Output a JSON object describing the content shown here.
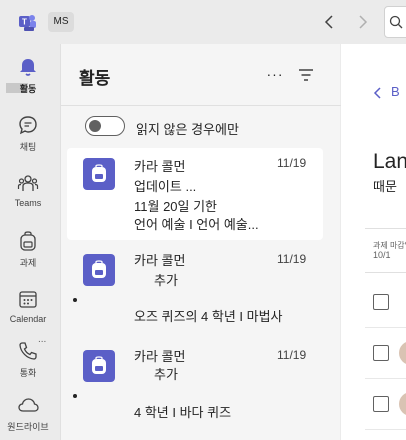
{
  "topbar": {
    "tenant": "MS",
    "app_icon": "teams-icon",
    "nav_back_icon": "chevron-left-icon",
    "nav_forward_icon": "chevron-right-icon",
    "search_icon": "search-icon"
  },
  "rail": {
    "items": [
      {
        "label": "활동",
        "icon": "bell-icon",
        "active": true
      },
      {
        "label": "채팅",
        "icon": "chat-icon"
      },
      {
        "label": "Teams",
        "icon": "people-icon"
      },
      {
        "label": "과제",
        "icon": "backpack-icon"
      },
      {
        "label": "Calendar",
        "icon": "calendar-icon"
      },
      {
        "label": "통화",
        "icon": "phone-icon"
      },
      {
        "label": "원드라이브",
        "icon": "cloud-icon"
      }
    ],
    "more_label": "..."
  },
  "activity": {
    "title": "활동",
    "more_label": "···",
    "filter_icon": "filter-icon",
    "toggle_label": "읽지 않은 경우에만",
    "items": [
      {
        "line1": "카라 콜먼",
        "line2": "업데이트 ...",
        "line3": "11월 20일 기한",
        "line4": "언어 예술 I 언어 예술...",
        "time": "11/19",
        "unread": false,
        "selected": true
      },
      {
        "line1": "카라 콜먼",
        "line2": "추가",
        "line3": "",
        "line4": "오즈 퀴즈의 4 학년 I 마법사",
        "time": "11/19",
        "unread": true,
        "selected": false
      },
      {
        "line1": "카라 콜먼",
        "line2": "추가",
        "line3": "",
        "line4": "4 학년 I 바다 퀴즈",
        "time": "11/19",
        "unread": true,
        "selected": false
      }
    ]
  },
  "right": {
    "back_label": "B",
    "title": "Lan",
    "subtitle": "때문",
    "col_header": "과제 마감일",
    "col_header2": "10/1",
    "colors": {
      "accent": "#5b5fc7"
    }
  }
}
